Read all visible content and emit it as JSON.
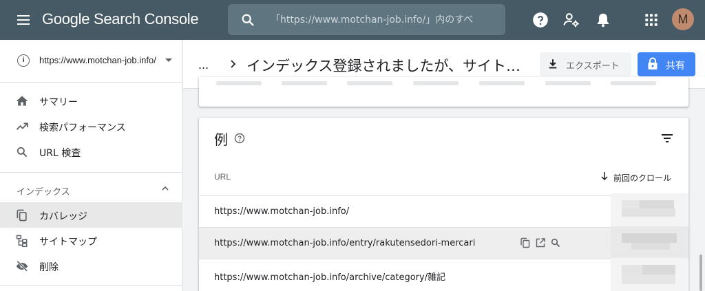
{
  "app": {
    "title": "Google Search Console",
    "search_placeholder": "「https://www.motchan-job.info/」内のすべ",
    "avatar_initial": "M",
    "colors": {
      "topbar": "#455a64",
      "accent": "#4285f4",
      "sidebar_active": "#e8e8e8"
    }
  },
  "sidebar": {
    "property": "https://www.motchan-job.info/",
    "items": [
      {
        "label": "サマリー",
        "icon": "home-icon"
      },
      {
        "label": "検索パフォーマンス",
        "icon": "trending-up-icon"
      },
      {
        "label": "URL 検査",
        "icon": "search-icon"
      }
    ],
    "section": {
      "label": "インデックス",
      "expanded": true
    },
    "section_items": [
      {
        "label": "カバレッジ",
        "icon": "copy-icon",
        "active": true
      },
      {
        "label": "サイトマップ",
        "icon": "sitemap-icon"
      },
      {
        "label": "削除",
        "icon": "eye-off-icon"
      }
    ]
  },
  "header": {
    "breadcrumb_ellipsis": "...",
    "page_title": "インデックス登録されましたが、サイト…",
    "export_label": "エクスポート",
    "share_label": "共有"
  },
  "examples": {
    "title": "例",
    "col_url": "URL",
    "col_last_crawl": "前回のクロール",
    "rows": [
      {
        "url": "https://www.motchan-job.info/"
      },
      {
        "url": "https://www.motchan-job.info/entry/rakutensedori-mercari",
        "hovered": true
      },
      {
        "url": "https://www.motchan-job.info/archive/category/雑記"
      }
    ]
  }
}
